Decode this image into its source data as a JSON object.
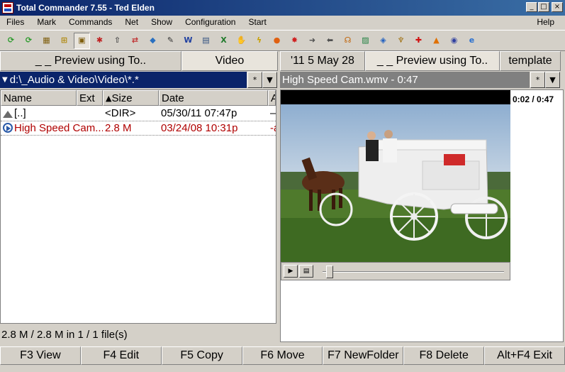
{
  "window": {
    "title": "Total Commander 7.55 - Ted Elden",
    "minimize": "_",
    "maximize": "□",
    "close": "×"
  },
  "menu": {
    "items": [
      "Files",
      "Mark",
      "Commands",
      "Net",
      "Show",
      "Configuration",
      "Start"
    ],
    "help": "Help"
  },
  "toolbar": {
    "buttons": [
      {
        "name": "refresh-icon",
        "glyph": "⟳",
        "color": "#2a9a2a"
      },
      {
        "name": "refresh-other-icon",
        "glyph": "⟳",
        "color": "#2a9a2a"
      },
      {
        "name": "thumbnail-icon",
        "glyph": "▦",
        "color": "#806010"
      },
      {
        "name": "tree-icon",
        "glyph": "⊞",
        "color": "#b08a10"
      },
      {
        "name": "quick-view-icon",
        "glyph": "▣",
        "color": "#806010"
      },
      {
        "name": "select-icon",
        "glyph": "✱",
        "color": "#c02020"
      },
      {
        "name": "up-directory-icon",
        "glyph": "⇧",
        "color": "#505050"
      },
      {
        "name": "ftp-icon",
        "glyph": "⇄",
        "color": "#c03030"
      },
      {
        "name": "pack-icon",
        "glyph": "◆",
        "color": "#2a70c0"
      },
      {
        "name": "edit-icon",
        "glyph": "✎",
        "color": "#303030"
      },
      {
        "name": "word-icon",
        "glyph": "W",
        "color": "#2040a0"
      },
      {
        "name": "document-icon",
        "glyph": "▤",
        "color": "#305080"
      },
      {
        "name": "excel-icon",
        "glyph": "X",
        "color": "#1f7a2a"
      },
      {
        "name": "hand-icon",
        "glyph": "✋",
        "color": "#d07010"
      },
      {
        "name": "lightning-icon",
        "glyph": "ϟ",
        "color": "#c8a000"
      },
      {
        "name": "app-icon",
        "glyph": "●",
        "color": "#e06010"
      },
      {
        "name": "bug-icon",
        "glyph": "✸",
        "color": "#d02020"
      },
      {
        "name": "arrow-right-icon",
        "glyph": "➜",
        "color": "#505050"
      },
      {
        "name": "arrow-left-icon",
        "glyph": "⬅",
        "color": "#505050"
      },
      {
        "name": "headphones-icon",
        "glyph": "☊",
        "color": "#c06000"
      },
      {
        "name": "image-icon",
        "glyph": "▨",
        "color": "#208040"
      },
      {
        "name": "pdf-icon",
        "glyph": "◈",
        "color": "#2060c0"
      },
      {
        "name": "tools-icon",
        "glyph": "♆",
        "color": "#a07010"
      },
      {
        "name": "first-aid-icon",
        "glyph": "✚",
        "color": "#d01010"
      },
      {
        "name": "vlc-icon",
        "glyph": "▲",
        "color": "#e07000"
      },
      {
        "name": "settings-icon",
        "glyph": "◉",
        "color": "#3040a0"
      },
      {
        "name": "internet-explorer-icon",
        "glyph": "e",
        "color": "#2a70d0"
      }
    ]
  },
  "left_panel": {
    "tabs": [
      "_ _ Preview using To..",
      "Video"
    ],
    "path": "d:\\_Audio & Video\\Video\\*.*",
    "filter_button": "*",
    "dropdown_button": "▼",
    "columns": {
      "name": "Name",
      "ext": "Ext",
      "size": "Size",
      "date": "Date",
      "attr": "A"
    },
    "rows": [
      {
        "name": "[..]",
        "ext": "",
        "size": "<DIR>",
        "date": "05/30/11 07:47p",
        "attr": "—"
      },
      {
        "name": "High Speed Cam...",
        "ext": "",
        "size": "2.8 M",
        "date": "03/24/08 10:31p",
        "attr": "-a"
      }
    ],
    "status": "2.8 M / 2.8 M in 1 / 1 file(s)"
  },
  "right_panel": {
    "tabs": [
      "'11  5 May 28",
      "_ _ Preview using To..",
      "template"
    ],
    "path": "High Speed Cam.wmv - 0:47",
    "filter_button": "*",
    "dropdown_button": "▼",
    "timecode": "0:02 / 0:47",
    "playback_progress": 0.04,
    "play_label": "▶",
    "menu_label": "▤"
  },
  "fkeys": [
    "F3 View",
    "F4 Edit",
    "F5 Copy",
    "F6 Move",
    "F7 NewFolder",
    "F8 Delete",
    "Alt+F4 Exit"
  ]
}
